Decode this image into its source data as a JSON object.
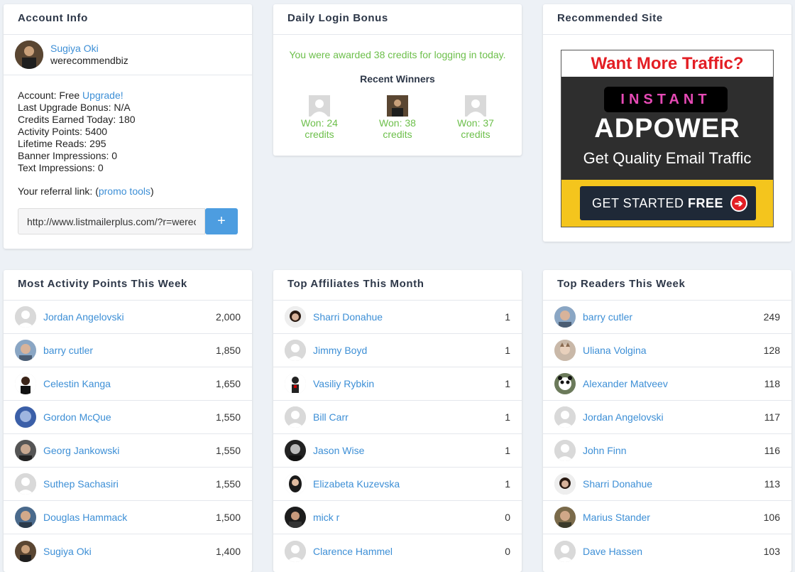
{
  "account": {
    "title": "Account Info",
    "user_name": "Sugiya Oki",
    "username": "werecommendbiz",
    "account_label": "Account: Free ",
    "upgrade_link": "Upgrade!",
    "last_upgrade_bonus": "Last Upgrade Bonus: N/A",
    "credits_today": "Credits Earned Today: 180",
    "activity_points": "Activity Points: 5400",
    "lifetime_reads": "Lifetime Reads: 295",
    "banner_impressions": "Banner Impressions: 0",
    "text_impressions": "Text Impressions: 0",
    "referral_label": "Your referral link: (",
    "promo_tools": "promo tools",
    "referral_close": ")",
    "referral_url": "http://www.listmailerplus.com/?r=werecommendbiz",
    "add_button": "+"
  },
  "bonus": {
    "title": "Daily Login Bonus",
    "message": "You were awarded 38 credits for logging in today.",
    "winners_title": "Recent Winners",
    "winners": [
      {
        "won": "Won: 24",
        "unit": "credits"
      },
      {
        "won": "Won: 38",
        "unit": "credits"
      },
      {
        "won": "Won: 37",
        "unit": "credits"
      }
    ]
  },
  "recommended": {
    "title": "Recommended Site",
    "ad_headline": "Want More Traffic?",
    "ad_instant": "INSTANT",
    "ad_brand": "ADPOWER",
    "ad_tagline": "Get Quality Email Traffic",
    "ad_cta_regular": "GET STARTED ",
    "ad_cta_bold": "FREE",
    "ad_arrow": "➔"
  },
  "activity": {
    "title": "Most Activity Points This Week",
    "rows": [
      {
        "name": "Jordan Angelovski",
        "value": "2,000"
      },
      {
        "name": "barry cutler",
        "value": "1,850"
      },
      {
        "name": "Celestin Kanga",
        "value": "1,650"
      },
      {
        "name": "Gordon McQue",
        "value": "1,550"
      },
      {
        "name": "Georg Jankowski",
        "value": "1,550"
      },
      {
        "name": "Suthep Sachasiri",
        "value": "1,550"
      },
      {
        "name": "Douglas Hammack",
        "value": "1,500"
      },
      {
        "name": "Sugiya Oki",
        "value": "1,400"
      }
    ]
  },
  "affiliates": {
    "title": "Top Affiliates This Month",
    "rows": [
      {
        "name": "Sharri Donahue",
        "value": "1"
      },
      {
        "name": "Jimmy Boyd",
        "value": "1"
      },
      {
        "name": "Vasiliy Rybkin",
        "value": "1"
      },
      {
        "name": "Bill Carr",
        "value": "1"
      },
      {
        "name": "Jason Wise",
        "value": "1"
      },
      {
        "name": "Elizabeta Kuzevska",
        "value": "1"
      },
      {
        "name": "mick r",
        "value": "0"
      },
      {
        "name": "Clarence Hammel",
        "value": "0"
      }
    ]
  },
  "readers": {
    "title": "Top Readers This Week",
    "rows": [
      {
        "name": "barry cutler",
        "value": "249"
      },
      {
        "name": "Uliana Volgina",
        "value": "128"
      },
      {
        "name": "Alexander Matveev",
        "value": "118"
      },
      {
        "name": "Jordan Angelovski",
        "value": "117"
      },
      {
        "name": "John Finn",
        "value": "116"
      },
      {
        "name": "Sharri Donahue",
        "value": "113"
      },
      {
        "name": "Marius Stander",
        "value": "106"
      },
      {
        "name": "Dave Hassen",
        "value": "103"
      }
    ]
  },
  "colors": {
    "link": "#3d8fd6",
    "success": "#6cbf4a",
    "button": "#4d9de0",
    "page_bg": "#edf1f6"
  }
}
